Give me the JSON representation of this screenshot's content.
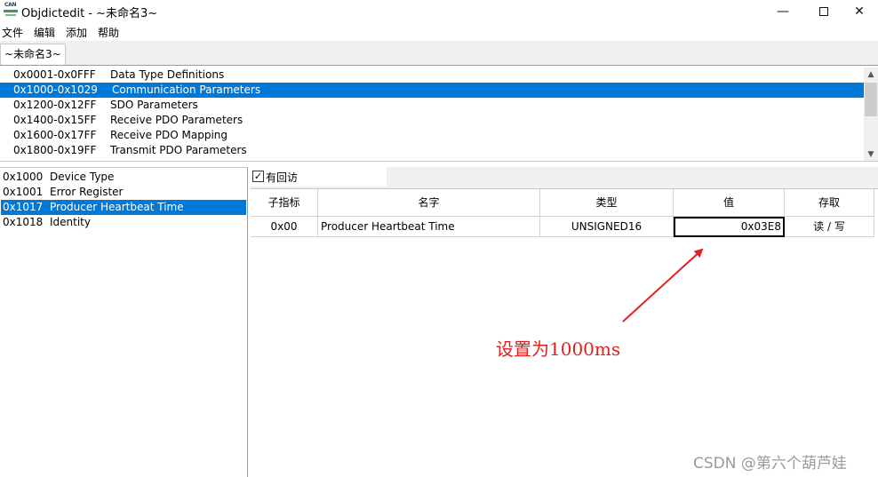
{
  "window": {
    "title": "Objdictedit - ~未命名3~",
    "app_icon_text": "CAN",
    "minimize_glyph": "—",
    "close_glyph": "✕"
  },
  "menu": [
    "文件",
    "编辑",
    "添加",
    "帮助"
  ],
  "tab": {
    "label": "~未命名3~"
  },
  "index_ranges": [
    {
      "range": "0x0001-0x0FFF",
      "name": "Data Type Definitions",
      "selected": false
    },
    {
      "range": "0x1000-0x1029",
      "name": "Communication Parameters",
      "selected": true
    },
    {
      "range": "0x1200-0x12FF",
      "name": "SDO Parameters",
      "selected": false
    },
    {
      "range": "0x1400-0x15FF",
      "name": "Receive PDO Parameters",
      "selected": false
    },
    {
      "range": "0x1600-0x17FF",
      "name": "Receive PDO Mapping",
      "selected": false
    },
    {
      "range": "0x1800-0x19FF",
      "name": "Transmit PDO Parameters",
      "selected": false
    }
  ],
  "scrollbar": {
    "up_glyph": "▲",
    "down_glyph": "▼"
  },
  "index_list": [
    {
      "index": "0x1000",
      "name": "Device Type",
      "selected": false
    },
    {
      "index": "0x1001",
      "name": "Error Register",
      "selected": false
    },
    {
      "index": "0x1017",
      "name": "Producer Heartbeat Time",
      "selected": true
    },
    {
      "index": "0x1018",
      "name": "Identity",
      "selected": false
    }
  ],
  "checkbox": {
    "label": "有回访",
    "checked": true,
    "check_glyph": "✓"
  },
  "grid": {
    "headers": [
      "子指标",
      "名字",
      "类型",
      "值",
      "存取"
    ],
    "rows": [
      {
        "subindex": "0x00",
        "name": "Producer Heartbeat Time",
        "type": "UNSIGNED16",
        "value": "0x03E8",
        "access": "读 / 写"
      }
    ]
  },
  "annotation": {
    "text": "设置为1000ms",
    "color": "#e02020"
  },
  "watermark": "CSDN @第六个葫芦娃",
  "colors": {
    "selection": "#0078d7",
    "panel_bg": "#f0f0f0"
  }
}
